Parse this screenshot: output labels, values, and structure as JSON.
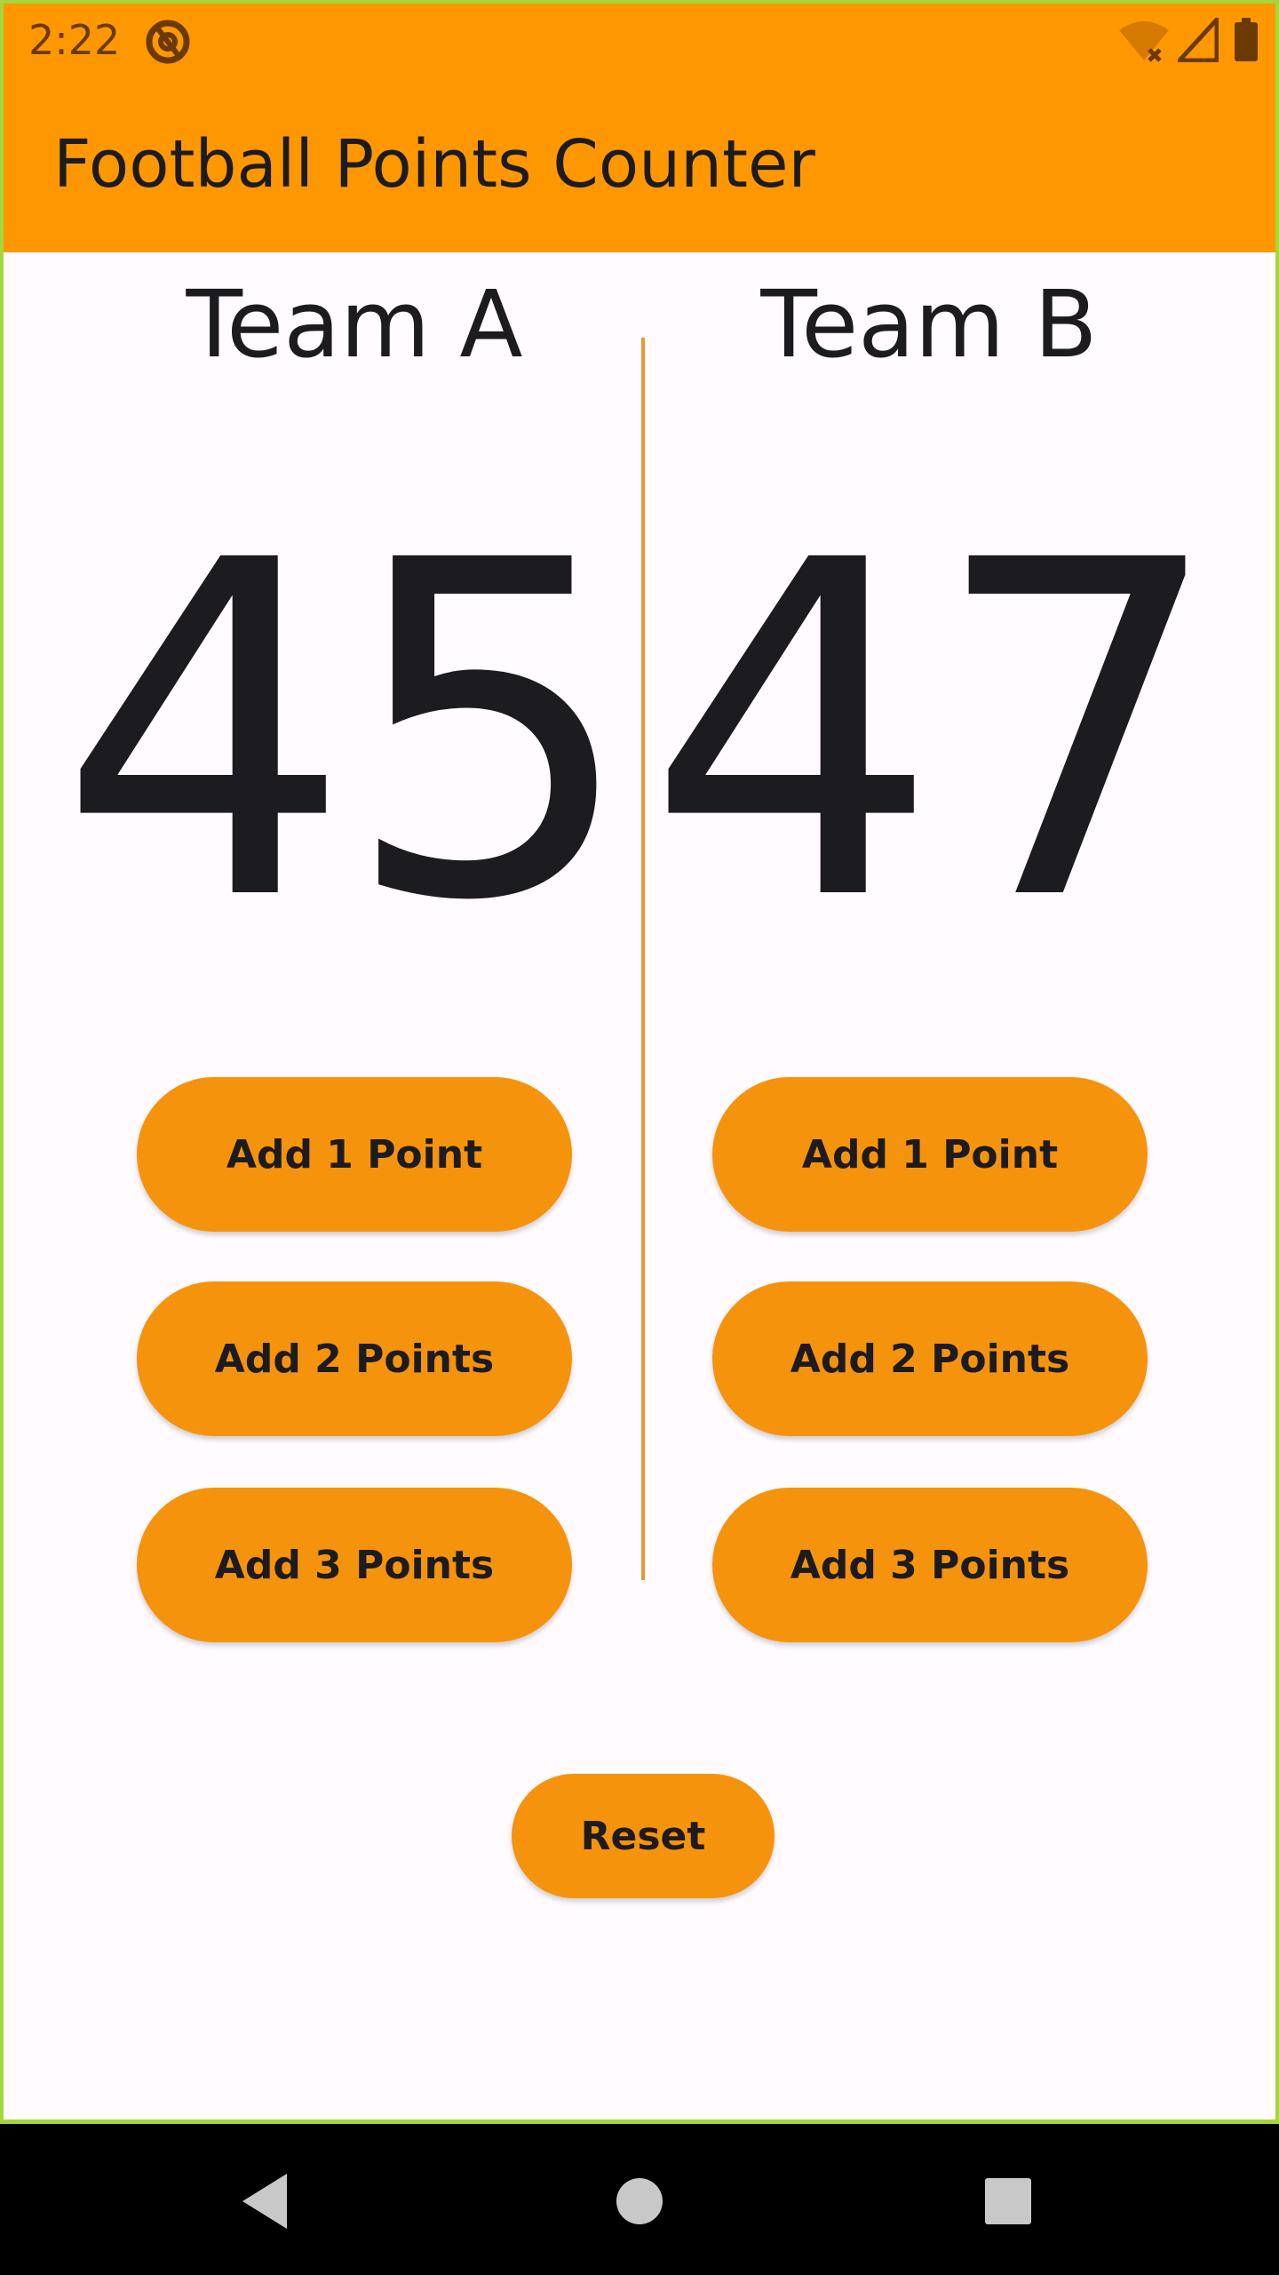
{
  "status_bar": {
    "time": "2:22",
    "icons": [
      "app-notification-icon",
      "wifi-off-icon",
      "signal-icon",
      "battery-icon"
    ]
  },
  "app_bar": {
    "title": "Football Points Counter"
  },
  "team_a": {
    "name": "Team A",
    "score": "45",
    "buttons": [
      "Add 1 Point",
      "Add 2 Points",
      "Add 3 Points"
    ]
  },
  "team_b": {
    "name": "Team B",
    "score": "47",
    "buttons": [
      "Add 1 Point",
      "Add 2 Points",
      "Add 3 Points"
    ]
  },
  "reset_label": "Reset",
  "nav": {
    "icons": [
      "back-icon",
      "home-icon",
      "recents-icon"
    ]
  },
  "colors": {
    "primary": "#ff9800",
    "button": "#f6930c",
    "divider": "#e29a32",
    "text": "#1c1b1f",
    "background": "#fffbfe"
  }
}
